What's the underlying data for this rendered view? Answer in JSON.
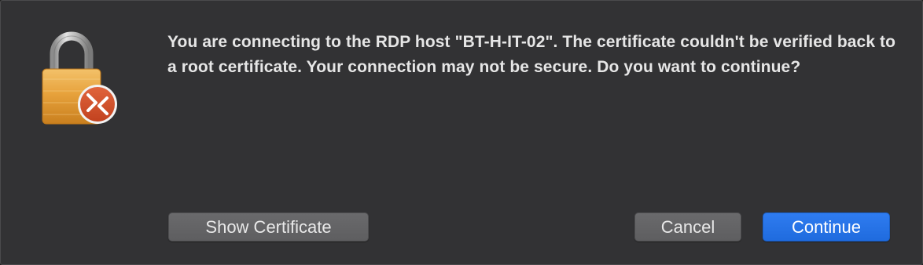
{
  "dialog": {
    "message": "You are connecting to the RDP host \"BT-H-IT-02\". The certificate couldn't be verified back to a root certificate. Your connection may not be secure. Do you want to continue?",
    "icon": "lock-icon",
    "badge_icon": "remote-desktop-icon"
  },
  "buttons": {
    "show_certificate": "Show Certificate",
    "cancel": "Cancel",
    "continue": "Continue"
  },
  "colors": {
    "background": "#323234",
    "text": "#e6e6e6",
    "primary_button": "#2671e8",
    "secondary_button": "#636365",
    "badge": "#d6512f",
    "lock_body": "#e6a33b"
  }
}
